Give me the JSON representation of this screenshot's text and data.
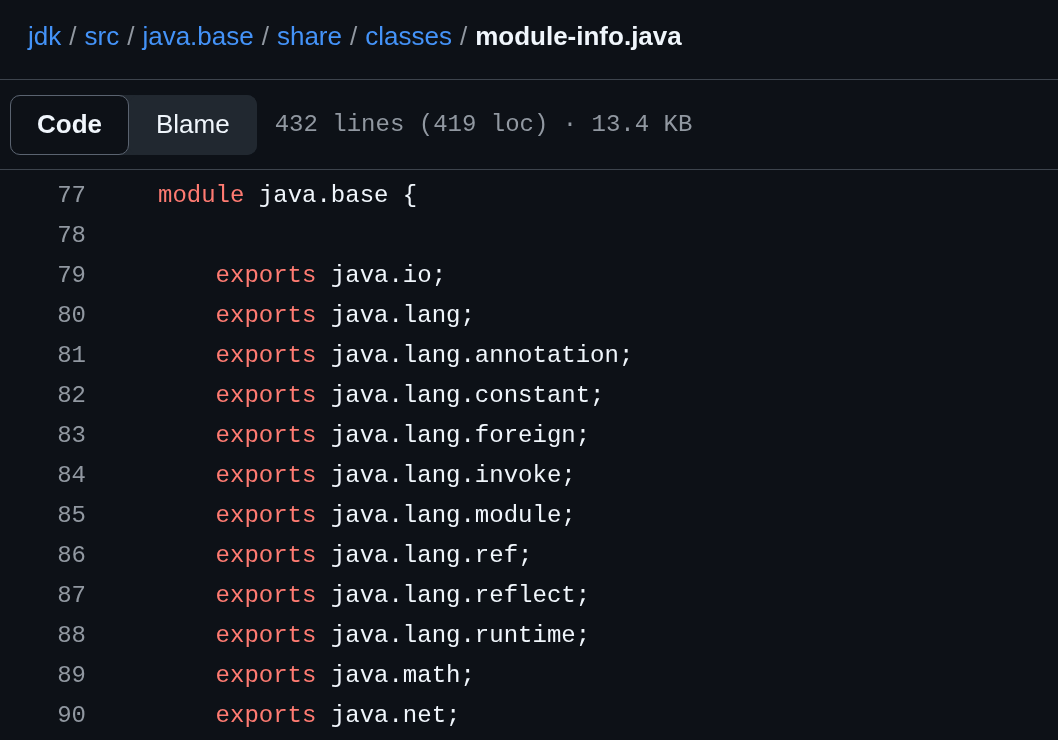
{
  "breadcrumb": [
    {
      "kind": "link",
      "text": "jdk"
    },
    {
      "kind": "separator",
      "text": "/"
    },
    {
      "kind": "link",
      "text": "src"
    },
    {
      "kind": "separator",
      "text": "/"
    },
    {
      "kind": "link",
      "text": "java.base"
    },
    {
      "kind": "separator",
      "text": "/"
    },
    {
      "kind": "link",
      "text": "share"
    },
    {
      "kind": "separator",
      "text": "/"
    },
    {
      "kind": "link",
      "text": "classes"
    },
    {
      "kind": "separator",
      "text": "/"
    },
    {
      "kind": "current",
      "text": "module-info.java"
    }
  ],
  "tabs": [
    {
      "label": "Code",
      "selected": true
    },
    {
      "label": "Blame",
      "selected": false
    }
  ],
  "file_info": "432 lines (419 loc) · 13.4 KB",
  "code_lines": [
    {
      "number": "77",
      "tokens": [
        {
          "kind": "keyword",
          "text": "module"
        },
        {
          "kind": "plain",
          "text": " java.base {"
        }
      ]
    },
    {
      "number": "78"
    },
    {
      "number": "79",
      "tokens": [
        {
          "kind": "keyword",
          "text": "    exports"
        },
        {
          "kind": "plain",
          "text": " java.io;"
        }
      ]
    },
    {
      "number": "80",
      "tokens": [
        {
          "kind": "keyword",
          "text": "    exports"
        },
        {
          "kind": "plain",
          "text": " java.lang;"
        }
      ]
    },
    {
      "number": "81",
      "tokens": [
        {
          "kind": "keyword",
          "text": "    exports"
        },
        {
          "kind": "plain",
          "text": " java.lang.annotation;"
        }
      ]
    },
    {
      "number": "82",
      "tokens": [
        {
          "kind": "keyword",
          "text": "    exports"
        },
        {
          "kind": "plain",
          "text": " java.lang.constant;"
        }
      ]
    },
    {
      "number": "83",
      "tokens": [
        {
          "kind": "keyword",
          "text": "    exports"
        },
        {
          "kind": "plain",
          "text": " java.lang.foreign;"
        }
      ]
    },
    {
      "number": "84",
      "tokens": [
        {
          "kind": "keyword",
          "text": "    exports"
        },
        {
          "kind": "plain",
          "text": " java.lang.invoke;"
        }
      ]
    },
    {
      "number": "85",
      "tokens": [
        {
          "kind": "keyword",
          "text": "    exports"
        },
        {
          "kind": "plain",
          "text": " java.lang.module;"
        }
      ]
    },
    {
      "number": "86",
      "tokens": [
        {
          "kind": "keyword",
          "text": "    exports"
        },
        {
          "kind": "plain",
          "text": " java.lang.ref;"
        }
      ]
    },
    {
      "number": "87",
      "tokens": [
        {
          "kind": "keyword",
          "text": "    exports"
        },
        {
          "kind": "plain",
          "text": " java.lang.reflect;"
        }
      ]
    },
    {
      "number": "88",
      "tokens": [
        {
          "kind": "keyword",
          "text": "    exports"
        },
        {
          "kind": "plain",
          "text": " java.lang.runtime;"
        }
      ]
    },
    {
      "number": "89",
      "tokens": [
        {
          "kind": "keyword",
          "text": "    exports"
        },
        {
          "kind": "plain",
          "text": " java.math;"
        }
      ]
    },
    {
      "number": "90",
      "tokens": [
        {
          "kind": "keyword",
          "text": "    exports"
        },
        {
          "kind": "plain",
          "text": " java.net;"
        }
      ]
    }
  ]
}
